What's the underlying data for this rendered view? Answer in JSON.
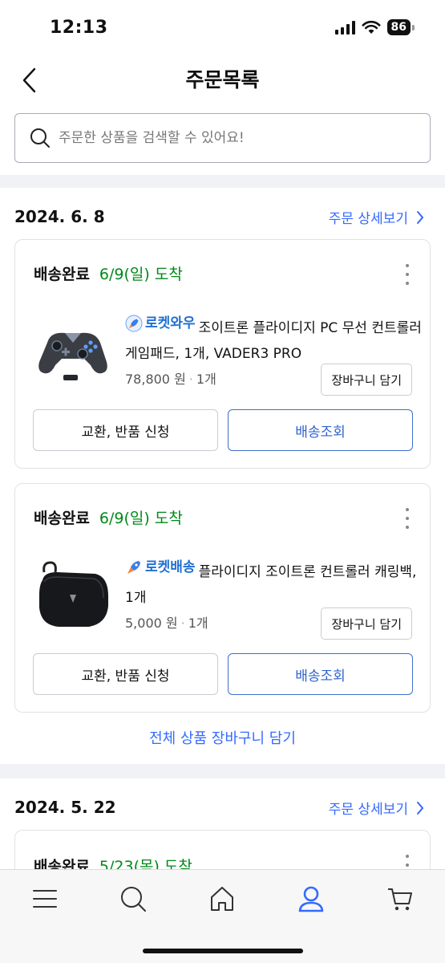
{
  "status_bar": {
    "time": "12:13",
    "battery": "86"
  },
  "header": {
    "title": "주문목록"
  },
  "search": {
    "placeholder": "주문한 상품을 검색할 수 있어요!"
  },
  "orders": [
    {
      "date": "2024. 6. 8",
      "detail_link": "주문 상세보기",
      "items": [
        {
          "status": "배송완료",
          "arrival": "6/9(일) 도착",
          "badge": "로켓와우",
          "name": "조이트론 플라이디지 PC 무선 컨트롤러 게임패드, 1개, VADER3 PRO",
          "price": "78,800 원",
          "qty": "1개",
          "cart_button": "장바구니 담기",
          "exchange_button": "교환, 반품 신청",
          "track_button": "배송조회"
        },
        {
          "status": "배송완료",
          "arrival": "6/9(일) 도착",
          "badge": "로켓배송",
          "name": "플라이디지 조이트론 컨트롤러 캐링백, 1개",
          "price": "5,000 원",
          "qty": "1개",
          "cart_button": "장바구니 담기",
          "exchange_button": "교환, 반품 신청",
          "track_button": "배송조회"
        }
      ],
      "all_cart": "전체 상품 장바구니 담기"
    },
    {
      "date": "2024. 5. 22",
      "detail_link": "주문 상세보기",
      "items": [
        {
          "status": "배송완료",
          "arrival": "5/23(목) 도착"
        }
      ]
    }
  ],
  "tabbar": {
    "items": [
      "menu-icon",
      "search-icon",
      "home-icon",
      "my-page-icon",
      "cart-icon"
    ],
    "active": "my-page-icon"
  },
  "colors": {
    "accent": "#346aff",
    "arrival": "#00891a",
    "wow_badge": "#1f6fd1"
  }
}
